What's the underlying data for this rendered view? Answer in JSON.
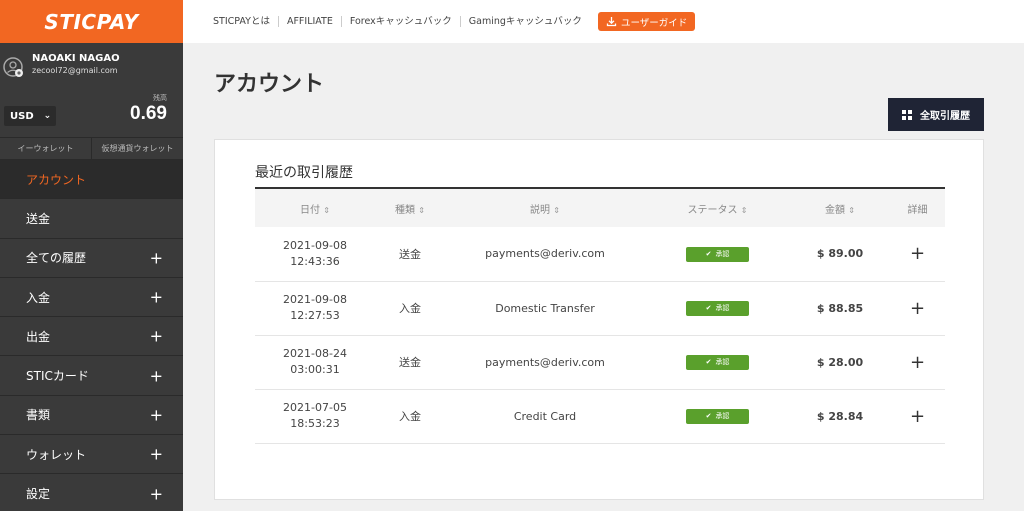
{
  "brand": {
    "logo_text": "STICPAY"
  },
  "user": {
    "name": "NAOAKI NAGAO",
    "email": "zecool72@gmail.com"
  },
  "balance": {
    "currency": "USD",
    "label": "残高",
    "value": "0.69"
  },
  "wallet_tabs": [
    "イーウォレット",
    "仮想通貨ウォレット"
  ],
  "sidebar": {
    "items": [
      {
        "label": "アカウント",
        "expandable": false
      },
      {
        "label": "送金",
        "expandable": false
      },
      {
        "label": "全ての履歴",
        "expandable": true
      },
      {
        "label": "入金",
        "expandable": true
      },
      {
        "label": "出金",
        "expandable": true
      },
      {
        "label": "STICカード",
        "expandable": true
      },
      {
        "label": "書類",
        "expandable": true
      },
      {
        "label": "ウォレット",
        "expandable": true
      },
      {
        "label": "設定",
        "expandable": true
      }
    ]
  },
  "topnav": {
    "links": [
      "STICPAYとは",
      "AFFILIATE",
      "Forexキャッシュバック",
      "Gamingキャッシュバック"
    ],
    "guide_label": "ユーザーガイド"
  },
  "page": {
    "title": "アカウント",
    "all_history_label": "全取引履歴"
  },
  "transactions": {
    "title": "最近の取引履歴",
    "columns": [
      "日付",
      "種類",
      "説明",
      "ステータス",
      "金額",
      "詳細"
    ],
    "rows": [
      {
        "date": "2021-09-08",
        "time": "12:43:36",
        "type": "送金",
        "description": "payments@deriv.com",
        "status": "承認",
        "amount": "$ 89.00"
      },
      {
        "date": "2021-09-08",
        "time": "12:27:53",
        "type": "入金",
        "description": "Domestic Transfer",
        "status": "承認",
        "amount": "$ 88.85"
      },
      {
        "date": "2021-08-24",
        "time": "03:00:31",
        "type": "送金",
        "description": "payments@deriv.com",
        "status": "承認",
        "amount": "$ 28.00"
      },
      {
        "date": "2021-07-05",
        "time": "18:53:23",
        "type": "入金",
        "description": "Credit Card",
        "status": "承認",
        "amount": "$ 28.84"
      }
    ]
  },
  "colors": {
    "brand_orange": "#f26722",
    "sidebar_bg": "#3a3a3a",
    "button_navy": "#1f2435",
    "status_green": "#5aa02c"
  }
}
